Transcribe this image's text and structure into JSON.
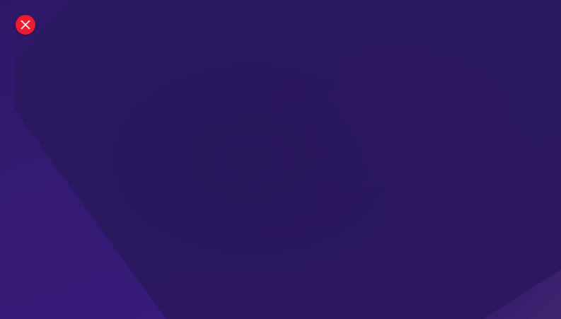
{
  "screen": {
    "background_color": "#2a1860",
    "accent_color": "#3b1c80"
  },
  "close_button": {
    "icon": "close-icon",
    "color": "#ec1c2e"
  }
}
